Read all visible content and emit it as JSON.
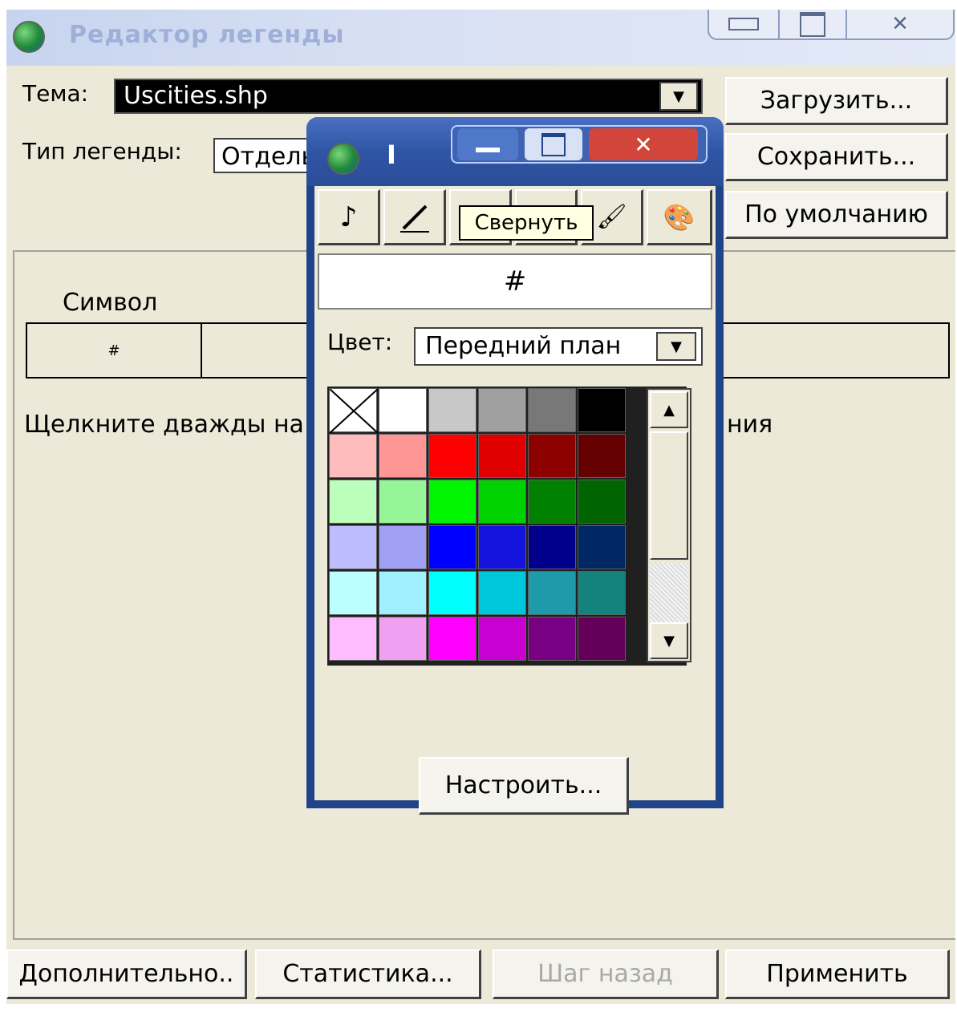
{
  "window": {
    "title": "Редактор легенды"
  },
  "controls": {
    "theme_label": "Тема:",
    "theme_value": "Uscities.shp",
    "legend_type_label": "Тип легенды:",
    "legend_type_value": "Отдельный символ"
  },
  "buttons": {
    "load": "Загрузить...",
    "save": "Сохранить...",
    "default": "По умолчанию",
    "advanced": "Дополнительно..",
    "statistics": "Статистика...",
    "undo": "Шаг назад",
    "apply": "Применить"
  },
  "table": {
    "symbol_header": "Символ",
    "row_symbol": "#"
  },
  "hint": {
    "left": "Щелкните дважды на",
    "right": "ния"
  },
  "popup": {
    "title": "I",
    "tooltip": "Свернуть",
    "symbol_preview": "#",
    "color_label": "Цвет:",
    "color_value": "Передний план",
    "customize_button": "Настроить...",
    "palette_rows": [
      [
        "none",
        "#ffffff",
        "#c8c8c8",
        "#a0a0a0",
        "#787878",
        "#000000"
      ],
      [
        "#ffbcbc",
        "#ff9696",
        "#ff0000",
        "#e00000",
        "#8c0000",
        "#640000"
      ],
      [
        "#bcffbc",
        "#96f596",
        "#00f500",
        "#00d200",
        "#008200",
        "#006400"
      ],
      [
        "#bcbcff",
        "#a0a0f5",
        "#0000ff",
        "#1414dc",
        "#00008c",
        "#002864"
      ],
      [
        "#bcffff",
        "#a0f0ff",
        "#00ffff",
        "#00c8dc",
        "#1e9baa",
        "#14827d"
      ],
      [
        "#ffbcff",
        "#f0a0f0",
        "#ff00ff",
        "#c800d2",
        "#780082",
        "#64005a"
      ]
    ]
  },
  "colors": {
    "accent": "#2f55a5",
    "popup_close": "#d2453a"
  }
}
